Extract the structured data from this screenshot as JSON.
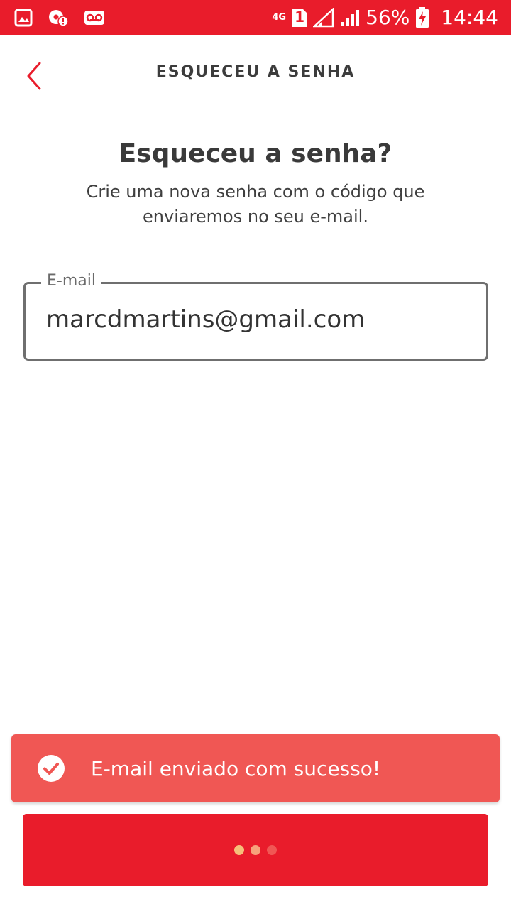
{
  "colors": {
    "brand_red": "#e91c2b",
    "toast_red": "#f05754",
    "text_dark": "#3a3a3a",
    "field_border": "#6f6f6f"
  },
  "status_bar": {
    "left_icons": [
      "gallery-icon",
      "location-alert-icon",
      "voicemail-icon"
    ],
    "network_type": "4G",
    "sim_slot": "1",
    "battery_percent": "56%",
    "time": "14:44"
  },
  "app_bar": {
    "back_icon": "chevron-left-icon",
    "title": "ESQUECEU A SENHA"
  },
  "content": {
    "heading": "Esqueceu a senha?",
    "subtitle": "Crie uma nova senha com o código que enviaremos no seu e-mail."
  },
  "email_field": {
    "label": "E-mail",
    "value": "marcdmartins@gmail.com"
  },
  "toast": {
    "icon": "check-circle-icon",
    "message": "E-mail enviado com sucesso!"
  },
  "submit_button": {
    "state": "loading",
    "loading_dots": [
      {
        "color": "#f6c07a"
      },
      {
        "color": "#f7a27c"
      },
      {
        "color": "#f05754"
      }
    ]
  }
}
